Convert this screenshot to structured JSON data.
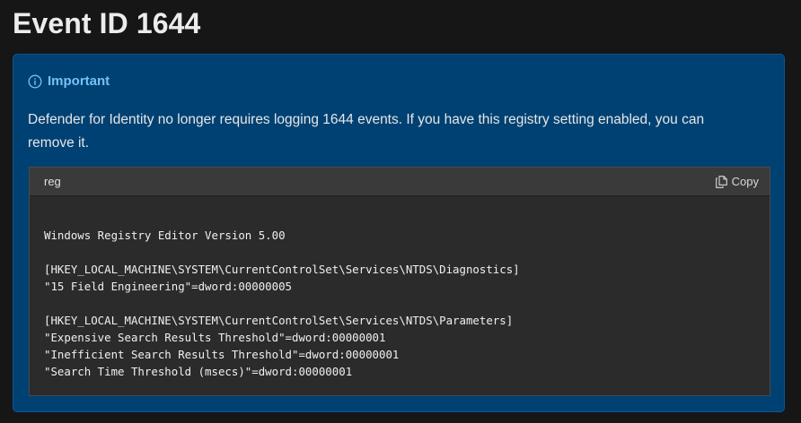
{
  "page": {
    "title": "Event ID 1644"
  },
  "alert": {
    "icon": "info-icon",
    "heading": "Important",
    "body": "Defender for Identity no longer requires logging 1644 events. If you have this registry setting enabled, you can remove it.",
    "colors": {
      "background": "#004173",
      "heading": "#75c1f7"
    }
  },
  "code_block": {
    "language": "reg",
    "copy_label": "Copy",
    "copy_icon": "copy-icon",
    "lines": [
      "Windows Registry Editor Version 5.00",
      "",
      "[HKEY_LOCAL_MACHINE\\SYSTEM\\CurrentControlSet\\Services\\NTDS\\Diagnostics]",
      "\"15 Field Engineering\"=dword:00000005",
      "",
      "[HKEY_LOCAL_MACHINE\\SYSTEM\\CurrentControlSet\\Services\\NTDS\\Parameters]",
      "\"Expensive Search Results Threshold\"=dword:00000001",
      "\"Inefficient Search Results Threshold\"=dword:00000001",
      "\"Search Time Threshold (msecs)\"=dword:00000001"
    ]
  }
}
